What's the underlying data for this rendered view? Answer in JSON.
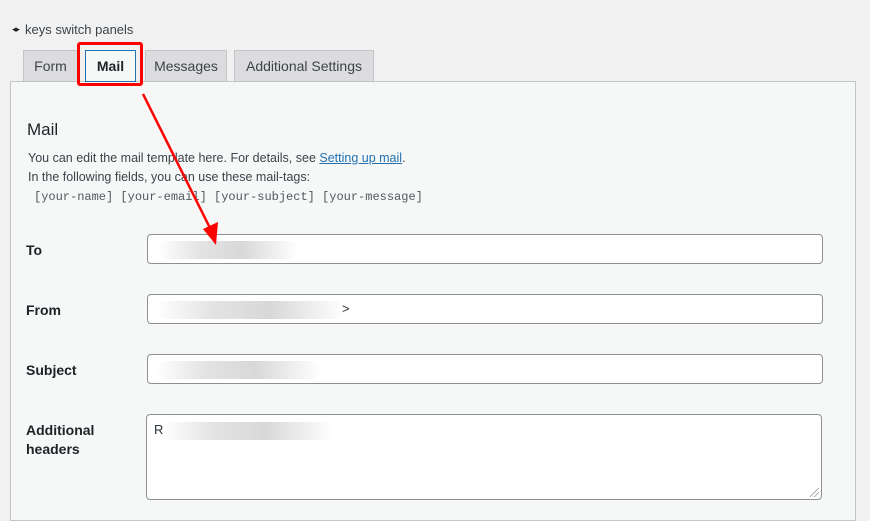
{
  "keys_hint": {
    "icon": "left-right-arrows-icon",
    "arrows_text": "◂▸",
    "label": "keys switch panels"
  },
  "tabs": [
    {
      "label": "Form",
      "active": false
    },
    {
      "label": "Mail",
      "active": true
    },
    {
      "label": "Messages",
      "active": false
    },
    {
      "label": "Additional Settings",
      "active": false
    }
  ],
  "mail_panel": {
    "title": "Mail",
    "desc_prefix": "You can edit the mail template here. For details, see ",
    "desc_link": "Setting up mail",
    "desc_suffix": ".",
    "desc_line2": "In the following fields, you can use these mail-tags:",
    "mail_tags": "[your-name] [your-email] [your-subject] [your-message]",
    "fields": {
      "to": {
        "label": "To",
        "value_blurred": true
      },
      "from": {
        "label": "From",
        "value_blurred": true,
        "visible_suffix": ">"
      },
      "subject": {
        "label": "Subject",
        "value_blurred": true
      },
      "additional_headers": {
        "label_line1": "Additional",
        "label_line2": "headers",
        "visible_prefix": "R",
        "value_blurred": true
      }
    }
  },
  "annotation": {
    "color": "#ff0000"
  }
}
